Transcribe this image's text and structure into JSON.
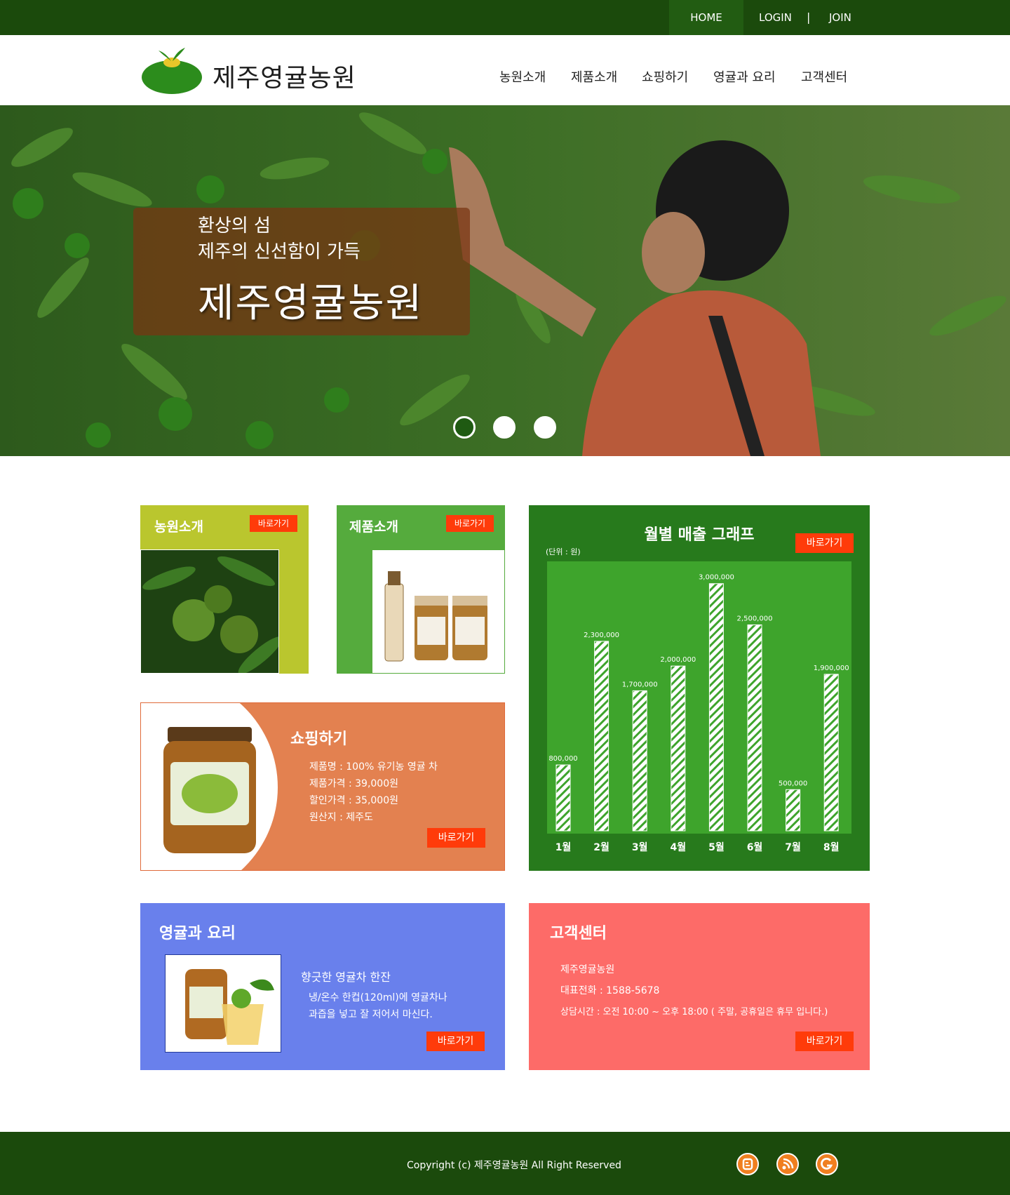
{
  "topbar": {
    "home": "HOME",
    "login": "LOGIN",
    "separator": "|",
    "join": "JOIN"
  },
  "header": {
    "logo_text": "제주영귤농원",
    "nav": [
      "농원소개",
      "제품소개",
      "쇼핑하기",
      "영귤과 요리",
      "고객센터"
    ]
  },
  "hero": {
    "line1": "환상의 섬",
    "line2": "제주의 신선함이 가득",
    "line3": "제주영귤농원",
    "active_slide": 1,
    "slides": 3
  },
  "cards": {
    "farm": {
      "title": "농원소개",
      "button": "바로가기"
    },
    "product": {
      "title": "제품소개",
      "button": "바로가기"
    },
    "shop": {
      "title": "쇼핑하기",
      "lines": [
        "제품명 : 100% 유기농 영귤 차",
        "제품가격 : 39,000원",
        "할인가격 : 35,000원",
        "원산지 : 제주도"
      ],
      "button": "바로가기"
    },
    "recipe": {
      "title": "영귤과 요리",
      "heading": "향긋한 영귤차 한잔",
      "lines": [
        "냉/온수 한컵(120ml)에 영귤차나",
        "과즙을 넣고 잘 저어서 마신다."
      ],
      "button": "바로가기"
    },
    "service": {
      "title": "고객센터",
      "lines": [
        "제주영귤농원",
        "대표전화 : 1588-5678",
        "상담시간 : 오전 10:00 ~ 오후 18:00 ( 주말, 공휴일은 휴무 입니다.)"
      ],
      "button": "바로가기"
    }
  },
  "chart_data": {
    "type": "bar",
    "title": "월별 매출 그래프",
    "unit_label": "(단위 : 원)",
    "button": "바로가기",
    "categories": [
      "1월",
      "2월",
      "3월",
      "4월",
      "5월",
      "6월",
      "7월",
      "8월"
    ],
    "values": [
      800000,
      2300000,
      1700000,
      2000000,
      3000000,
      2500000,
      500000,
      1900000
    ],
    "value_labels": [
      "800,000",
      "2,300,000",
      "1,700,000",
      "2,000,000",
      "3,000,000",
      "2,500,000",
      "500,000",
      "1,900,000"
    ],
    "ylim": [
      0,
      3100000
    ],
    "grid": false,
    "colors": {
      "background": "#3ea42c",
      "bar": "#ffffff",
      "stripe": "#3ea42c"
    }
  },
  "footer": {
    "copyright": "Copyright (c) 제주영귤농원 All Right Reserved"
  },
  "sns": [
    "blogger-icon",
    "rss-icon",
    "google-plus-icon"
  ],
  "colors": {
    "brand_dark": "#1b4a0c",
    "accent_button": "#ff3b0a",
    "farm_card": "#bac62e",
    "product_card": "#55ab3d",
    "shop_card": "#e38150",
    "recipe_card": "#6980ec",
    "service_card": "#fd6b68"
  }
}
